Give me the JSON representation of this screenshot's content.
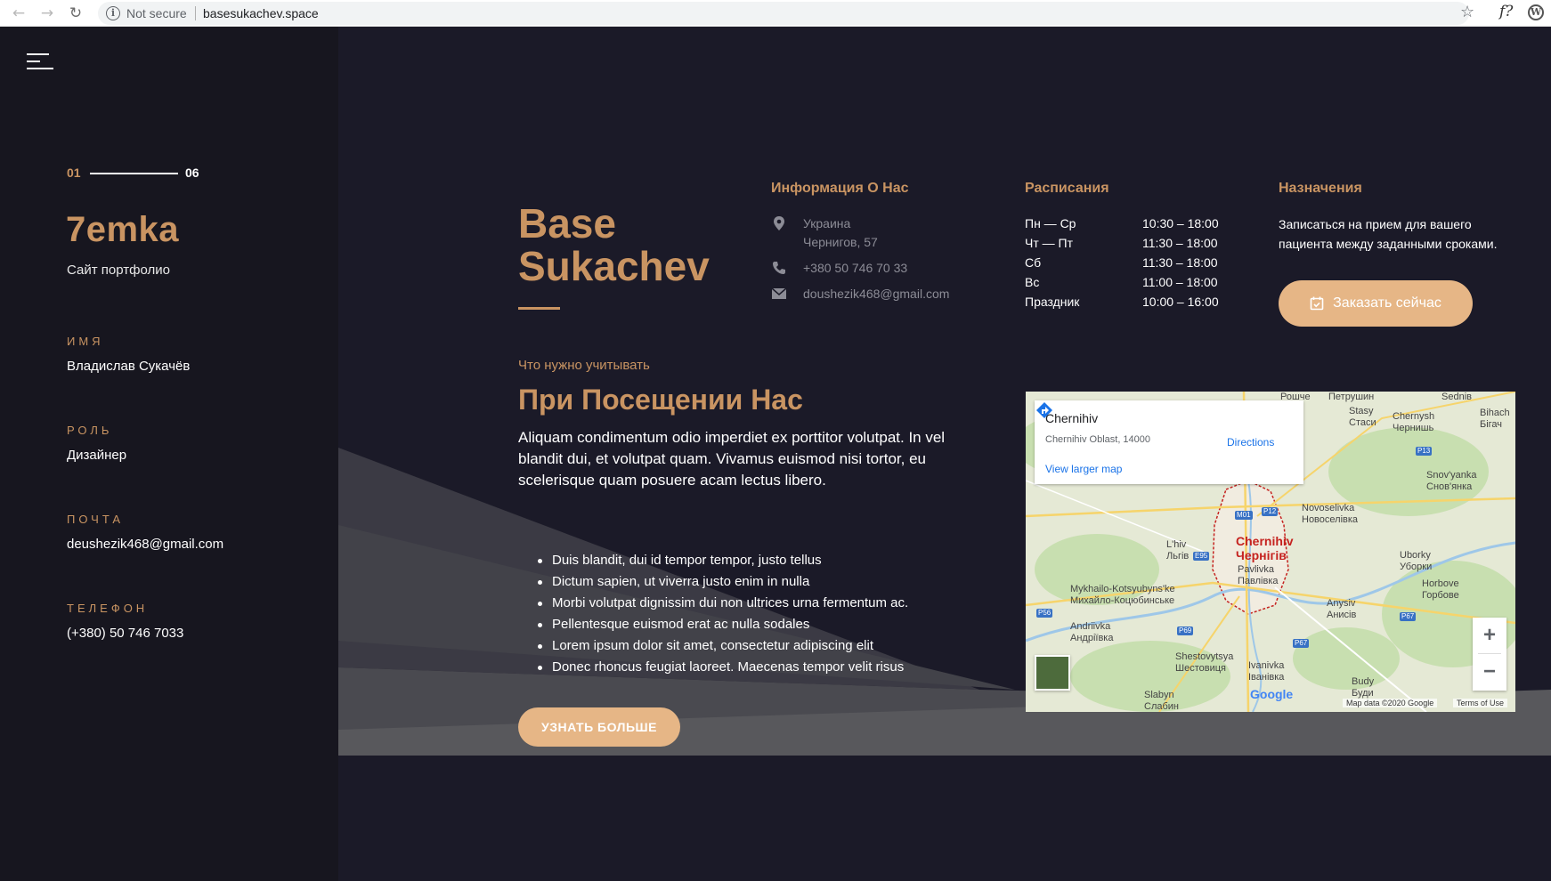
{
  "browser": {
    "security": "Not secure",
    "url": "basesukachev.space",
    "ext_label": "f?"
  },
  "sidebar": {
    "counter_start": "01",
    "counter_end": "06",
    "brand": "7emka",
    "brand_sub": "Сайт портфолио",
    "fields": [
      {
        "label": "ИМЯ",
        "value": "Владислав Сукачёв"
      },
      {
        "label": "РОЛЬ",
        "value": "Дизайнер"
      },
      {
        "label": "ПОЧТА",
        "value": "deushezik468@gmail.com"
      },
      {
        "label": "ТЕЛЕФОН",
        "value": "(+380) 50 746 7033"
      }
    ]
  },
  "main": {
    "headline_1": "Base",
    "headline_2": "Sukachev",
    "info_title": "Информация О Нас",
    "address_1": "Украина",
    "address_2": "Чернигов, 57",
    "phone": "+380 50 746 70 33",
    "email": "doushezik468@gmail.com",
    "schedule_title": "Расписания",
    "schedule": [
      {
        "day": "Пн — Ср",
        "time": "10:30 – 18:00"
      },
      {
        "day": "Чт — Пт",
        "time": "11:30 – 18:00"
      },
      {
        "day": "Сб",
        "time": "11:30 – 18:00"
      },
      {
        "day": "Вс",
        "time": "11:00 – 18:00"
      },
      {
        "day": "Праздник",
        "time": "10:00 – 16:00"
      }
    ],
    "appointments_title": "Назначения",
    "appointments_text": "Записаться на прием для вашего пациента между заданными сроками.",
    "book_label": "Заказать сейчас",
    "subhead": "Что нужно учитывать",
    "h2": "При Посещении Нас",
    "lead": "Aliquam condimentum odio imperdiet ex porttitor volutpat. In vel blandit dui, et volutpat quam. Vivamus euismod nisi tortor, eu scelerisque quam posuere acam lectus libero.",
    "bullets": [
      "Duis blandit, dui id tempor tempor, justo tellus",
      "Dictum sapien, ut viverra justo enim in nulla",
      "Morbi volutpat dignissim dui non ultrices urna fermentum ac.",
      "Pellentesque euismod erat ac nulla sodales",
      "Lorem ipsum dolor sit amet, consectetur adipiscing elit",
      "Donec rhoncus feugiat laoreet. Maecenas tempor velit risus"
    ],
    "more_label": "УЗНАТЬ БОЛЬШЕ"
  },
  "map": {
    "place": "Chernihiv",
    "address": "Chernihiv Oblast, 14000",
    "larger_link": "View larger map",
    "directions": "Directions",
    "city_label_1": "Chernihiv",
    "city_label_2": "Чернігів",
    "labels": [
      "Stasy\nСтаси",
      "Chernysh\nЧернишь",
      "Sednів",
      "Bihach\nБігач",
      "Snov'yanka\nСнов'янка",
      "Novoselivka\nНовоселівка",
      "L'hiv\nЛьгів",
      "Pavlivka\nПавлівка",
      "Uborky\nУборки",
      "Horbove\nГорбове",
      "Mykhailo-Kotsyubyns'ke\nМихайло-Коцюбинське",
      "Anysiv\nАнисів",
      "Andriivka\nАндріївка",
      "Shestovytsya\nШестовиця",
      "Ivanivka\nІванівка",
      "Slabyn\nСлабин",
      "Budy\nБуди",
      "Рошче",
      "Петрушин"
    ],
    "roads": [
      "M01",
      "P12",
      "P13",
      "E95",
      "P56",
      "P69",
      "P67",
      "P67"
    ],
    "attribution": "Map data ©2020 Google",
    "terms": "Terms of Use",
    "google": "Google"
  }
}
